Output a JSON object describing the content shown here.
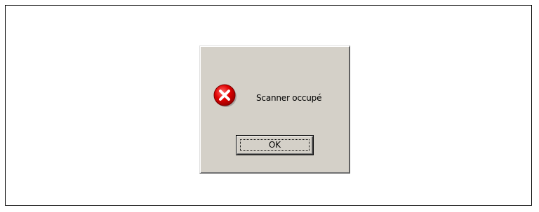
{
  "dialog": {
    "icon": "error-icon",
    "message": "Scanner occupé",
    "ok_label": "OK"
  },
  "colors": {
    "dialog_face": "#d4d0c8",
    "icon_red": "#e00000",
    "frame_border": "#000000"
  }
}
